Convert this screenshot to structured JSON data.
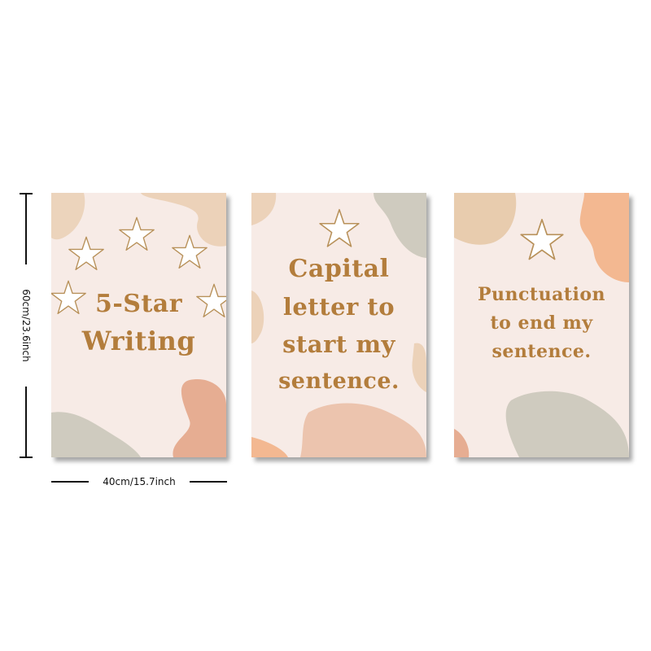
{
  "dimensions": {
    "height_label": "60cm/23.6inch",
    "width_label": "40cm/15.7inch"
  },
  "posters": [
    {
      "line1": "5-Star",
      "line2": "Writing",
      "stars": 5
    },
    {
      "line1": "Capital",
      "line2": "letter to",
      "line3": "start my",
      "line4": "sentence.",
      "stars": 1
    },
    {
      "line1": "Punctuation",
      "line2": "to end my",
      "line3": "sentence.",
      "stars": 1
    }
  ],
  "colors": {
    "background": "#f7ebe6",
    "text": "#b37d3c",
    "blob_tan": "#e8ccae",
    "blob_gray": "#cfcbbf",
    "blob_peach": "#f3b891",
    "blob_rose": "#e6ad92"
  }
}
